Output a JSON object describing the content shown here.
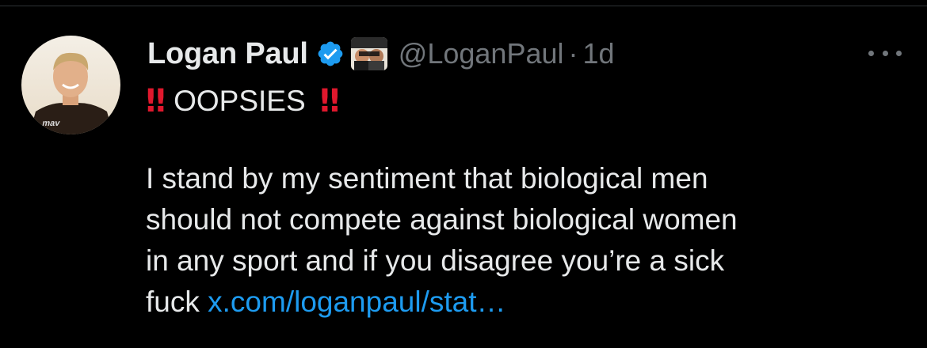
{
  "tweet": {
    "display_name": "Logan Paul",
    "handle": "@LoganPaul",
    "separator": "·",
    "timestamp": "1d",
    "headline": {
      "prefix_emoji": "‼",
      "text": "OOPSIES",
      "suffix_emoji": "‼"
    },
    "body_lines": [
      "I stand by my sentiment that biological men",
      "should not compete against biological women",
      "in any sport and if you disagree you’re a sick"
    ],
    "last_line_text": "fuck",
    "link_text": "x.com/loganpaul/stat…"
  },
  "icons": {
    "avatar": "profile-photo",
    "verified": "verified-badge-icon",
    "affiliate": "affiliate-badge",
    "more": "more-options-icon"
  },
  "colors": {
    "background": "#000000",
    "text_primary": "#e7e9ea",
    "text_secondary": "#71767b",
    "link": "#1d9bf0",
    "verified": "#1d9bf0",
    "emoji_red": "#e0182d"
  }
}
